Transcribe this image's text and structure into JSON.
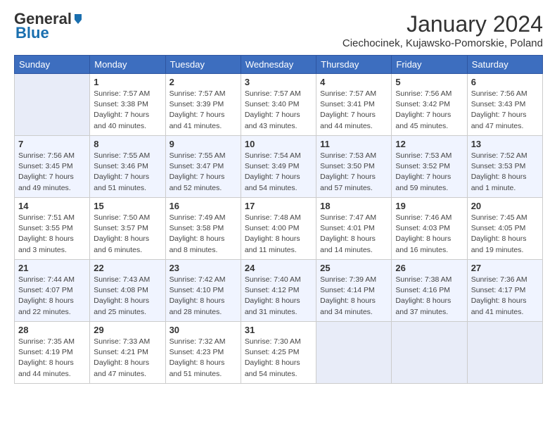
{
  "header": {
    "logo_general": "General",
    "logo_blue": "Blue",
    "month_year": "January 2024",
    "location": "Ciechocinek, Kujawsko-Pomorskie, Poland"
  },
  "days_of_week": [
    "Sunday",
    "Monday",
    "Tuesday",
    "Wednesday",
    "Thursday",
    "Friday",
    "Saturday"
  ],
  "weeks": [
    [
      {
        "day": "",
        "info": ""
      },
      {
        "day": "1",
        "info": "Sunrise: 7:57 AM\nSunset: 3:38 PM\nDaylight: 7 hours\nand 40 minutes."
      },
      {
        "day": "2",
        "info": "Sunrise: 7:57 AM\nSunset: 3:39 PM\nDaylight: 7 hours\nand 41 minutes."
      },
      {
        "day": "3",
        "info": "Sunrise: 7:57 AM\nSunset: 3:40 PM\nDaylight: 7 hours\nand 43 minutes."
      },
      {
        "day": "4",
        "info": "Sunrise: 7:57 AM\nSunset: 3:41 PM\nDaylight: 7 hours\nand 44 minutes."
      },
      {
        "day": "5",
        "info": "Sunrise: 7:56 AM\nSunset: 3:42 PM\nDaylight: 7 hours\nand 45 minutes."
      },
      {
        "day": "6",
        "info": "Sunrise: 7:56 AM\nSunset: 3:43 PM\nDaylight: 7 hours\nand 47 minutes."
      }
    ],
    [
      {
        "day": "7",
        "info": "Sunrise: 7:56 AM\nSunset: 3:45 PM\nDaylight: 7 hours\nand 49 minutes."
      },
      {
        "day": "8",
        "info": "Sunrise: 7:55 AM\nSunset: 3:46 PM\nDaylight: 7 hours\nand 51 minutes."
      },
      {
        "day": "9",
        "info": "Sunrise: 7:55 AM\nSunset: 3:47 PM\nDaylight: 7 hours\nand 52 minutes."
      },
      {
        "day": "10",
        "info": "Sunrise: 7:54 AM\nSunset: 3:49 PM\nDaylight: 7 hours\nand 54 minutes."
      },
      {
        "day": "11",
        "info": "Sunrise: 7:53 AM\nSunset: 3:50 PM\nDaylight: 7 hours\nand 57 minutes."
      },
      {
        "day": "12",
        "info": "Sunrise: 7:53 AM\nSunset: 3:52 PM\nDaylight: 7 hours\nand 59 minutes."
      },
      {
        "day": "13",
        "info": "Sunrise: 7:52 AM\nSunset: 3:53 PM\nDaylight: 8 hours\nand 1 minute."
      }
    ],
    [
      {
        "day": "14",
        "info": "Sunrise: 7:51 AM\nSunset: 3:55 PM\nDaylight: 8 hours\nand 3 minutes."
      },
      {
        "day": "15",
        "info": "Sunrise: 7:50 AM\nSunset: 3:57 PM\nDaylight: 8 hours\nand 6 minutes."
      },
      {
        "day": "16",
        "info": "Sunrise: 7:49 AM\nSunset: 3:58 PM\nDaylight: 8 hours\nand 8 minutes."
      },
      {
        "day": "17",
        "info": "Sunrise: 7:48 AM\nSunset: 4:00 PM\nDaylight: 8 hours\nand 11 minutes."
      },
      {
        "day": "18",
        "info": "Sunrise: 7:47 AM\nSunset: 4:01 PM\nDaylight: 8 hours\nand 14 minutes."
      },
      {
        "day": "19",
        "info": "Sunrise: 7:46 AM\nSunset: 4:03 PM\nDaylight: 8 hours\nand 16 minutes."
      },
      {
        "day": "20",
        "info": "Sunrise: 7:45 AM\nSunset: 4:05 PM\nDaylight: 8 hours\nand 19 minutes."
      }
    ],
    [
      {
        "day": "21",
        "info": "Sunrise: 7:44 AM\nSunset: 4:07 PM\nDaylight: 8 hours\nand 22 minutes."
      },
      {
        "day": "22",
        "info": "Sunrise: 7:43 AM\nSunset: 4:08 PM\nDaylight: 8 hours\nand 25 minutes."
      },
      {
        "day": "23",
        "info": "Sunrise: 7:42 AM\nSunset: 4:10 PM\nDaylight: 8 hours\nand 28 minutes."
      },
      {
        "day": "24",
        "info": "Sunrise: 7:40 AM\nSunset: 4:12 PM\nDaylight: 8 hours\nand 31 minutes."
      },
      {
        "day": "25",
        "info": "Sunrise: 7:39 AM\nSunset: 4:14 PM\nDaylight: 8 hours\nand 34 minutes."
      },
      {
        "day": "26",
        "info": "Sunrise: 7:38 AM\nSunset: 4:16 PM\nDaylight: 8 hours\nand 37 minutes."
      },
      {
        "day": "27",
        "info": "Sunrise: 7:36 AM\nSunset: 4:17 PM\nDaylight: 8 hours\nand 41 minutes."
      }
    ],
    [
      {
        "day": "28",
        "info": "Sunrise: 7:35 AM\nSunset: 4:19 PM\nDaylight: 8 hours\nand 44 minutes."
      },
      {
        "day": "29",
        "info": "Sunrise: 7:33 AM\nSunset: 4:21 PM\nDaylight: 8 hours\nand 47 minutes."
      },
      {
        "day": "30",
        "info": "Sunrise: 7:32 AM\nSunset: 4:23 PM\nDaylight: 8 hours\nand 51 minutes."
      },
      {
        "day": "31",
        "info": "Sunrise: 7:30 AM\nSunset: 4:25 PM\nDaylight: 8 hours\nand 54 minutes."
      },
      {
        "day": "",
        "info": ""
      },
      {
        "day": "",
        "info": ""
      },
      {
        "day": "",
        "info": ""
      }
    ]
  ]
}
